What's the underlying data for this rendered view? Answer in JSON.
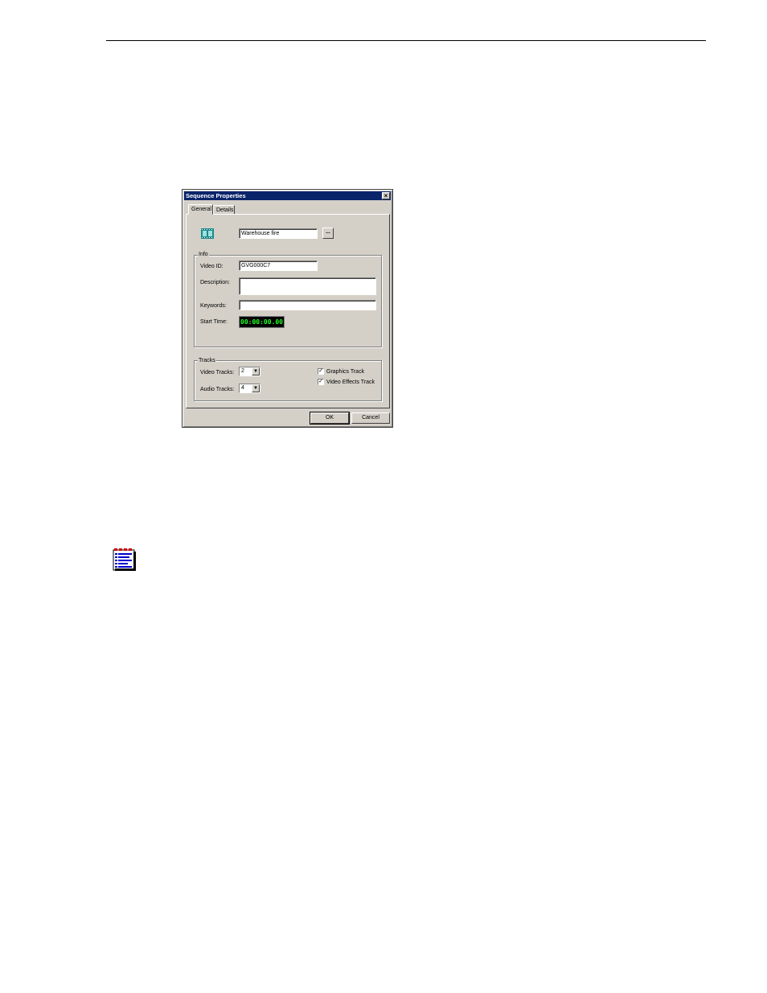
{
  "dialog": {
    "title": "Sequence Properties",
    "tabs": [
      "General",
      "Details"
    ],
    "name_value": "Warehouse fire",
    "browse_label": "...",
    "info": {
      "group_label": "Info",
      "video_id_label": "Video ID:",
      "video_id_value": "GVG000C7",
      "description_label": "Description:",
      "description_value": "",
      "keywords_label": "Keywords:",
      "keywords_value": "",
      "start_time_label": "Start Time:",
      "start_time_value": "00:00:00.00"
    },
    "tracks": {
      "group_label": "Tracks",
      "video_tracks_label": "Video Tracks:",
      "video_tracks_value": "2",
      "audio_tracks_label": "Audio Tracks:",
      "audio_tracks_value": "4",
      "graphics_track_label": "Graphics Track",
      "graphics_track_checked": true,
      "video_effects_label": "Video Effects Track",
      "video_effects_checked": true
    },
    "ok_label": "OK",
    "cancel_label": "Cancel",
    "colors": {
      "titlebar": "#0a246a",
      "timecode_text": "#22ff22",
      "window": "#d4d0c8"
    }
  },
  "icons": [
    "close-icon",
    "film-icon",
    "dropdown-arrow-icon",
    "checkmark-icon",
    "notes-icon"
  ]
}
